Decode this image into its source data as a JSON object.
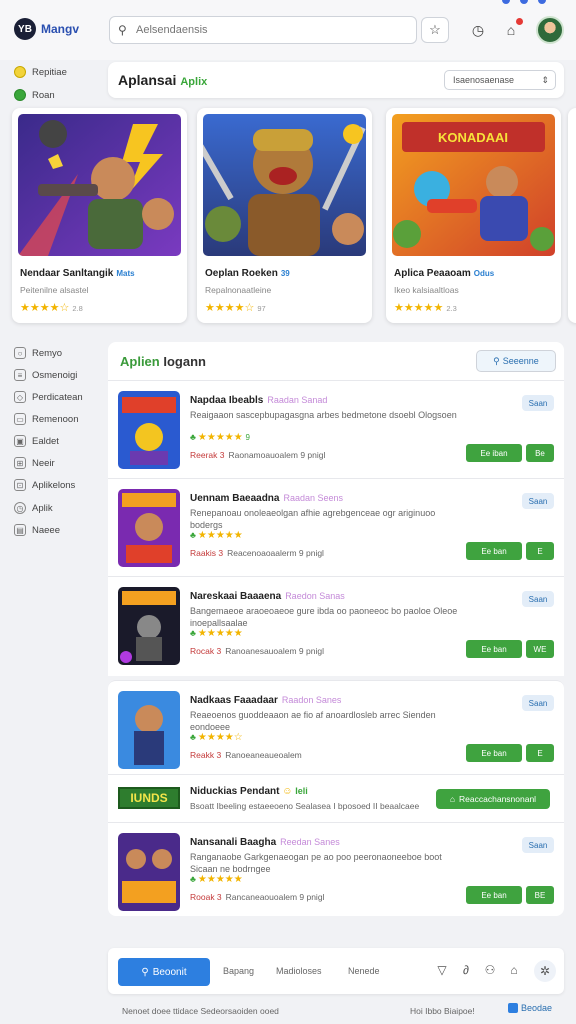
{
  "header": {
    "logo_text": "YB",
    "brand": "Mangv",
    "search_placeholder": "Aelsendaensis",
    "topdots": [
      "",
      "",
      ""
    ]
  },
  "sidebar_top": [
    {
      "label": "Repitiae",
      "icon": "star-icon"
    },
    {
      "label": "Roan",
      "icon": "leaf-icon"
    }
  ],
  "sidebar_nav": [
    {
      "label": "Remyo",
      "icon": "user-icon"
    },
    {
      "label": "Osmenoigi",
      "icon": "document-icon"
    },
    {
      "label": "Perdicatean",
      "icon": "tag-icon"
    },
    {
      "label": "Remenoon",
      "icon": "folder-icon"
    },
    {
      "label": "Ealdet",
      "icon": "image-icon"
    },
    {
      "label": "Neeir",
      "icon": "grid-icon"
    },
    {
      "label": "Aplikelons",
      "icon": "cart-icon"
    },
    {
      "label": "Aplik",
      "icon": "clock-icon"
    },
    {
      "label": "Naeee",
      "icon": "box-icon"
    }
  ],
  "featured": {
    "title": "Aplansai",
    "title_accent": "Aplix",
    "select_value": "Isaenosaenase",
    "cards": [
      {
        "title": "Nendaar Sanltangik",
        "tag": "Mats",
        "sub": "Peitenilne alsastel",
        "stars": "★★★★☆",
        "count": "2.8"
      },
      {
        "title": "Oeplan Roeken",
        "tag": "39",
        "sub": "Repalnonaatleine",
        "stars": "★★★★☆",
        "count": "97"
      },
      {
        "title": "Aplica Peaaoam",
        "tag": "Odus",
        "sub": "Ikeo kalsiaaltloas",
        "stars": "★★★★★",
        "count": "2.3"
      }
    ]
  },
  "list": {
    "title": "Aplien",
    "title2": "Iogann",
    "button": "Seeenne",
    "rows": [
      {
        "title": "Napdaa Ibeabls",
        "cat": "Raadan Sanad",
        "desc": "Reaigaaon sascepbupagasgna arbes bedmetone dsoebl Ologsoen",
        "stars": "★★★★★",
        "score": "9",
        "meta_red": "Reerak 3",
        "meta": "Raonamoauoalem   9 pnigl",
        "tag": "Saan",
        "b1": "Ee iban",
        "b2": "Be"
      },
      {
        "title": "Uennam Baeaadna",
        "cat": "Raadan Seens",
        "desc": "Renepanoau onoleaeolgan afhie agrebgenceae ogr ariginuoo bodergs",
        "stars": "★★★★★",
        "score": "",
        "meta_red": "Raakis 3",
        "meta": "Reacenoaoaalerm   9 pnigl",
        "tag": "Saan",
        "b1": "Ee ban",
        "b2": "E"
      },
      {
        "title": "Nareskaai Baaaena",
        "cat": "Raedon Sanas",
        "desc": "Bangemaeoe araoeoaeoe gure ibda oo paoneeoc bo paoloe Oleoe inoepallsaalae",
        "stars": "★★★★★",
        "score": "",
        "meta_red": "Rocak 3",
        "meta": "Ranoanesauoalem   9 pnigl",
        "tag": "Saan",
        "b1": "Ee ban",
        "b2": "WE"
      },
      {
        "title": "Nadkaas Faaadaar",
        "cat": "Raadon Sanes",
        "desc": "Reaeoenos guoddeaaon ae fio af anoardlosleb arrec Sienden eondoeee",
        "stars": "★★★★☆",
        "score": "",
        "meta_red": "Reakk 3",
        "meta": "Ranoeaneaueoalem",
        "tag": "Saan",
        "b1": "Ee ban",
        "b2": "E"
      },
      {
        "title": "Nansanali Baagha",
        "cat": "Reedan Sanes",
        "desc": "Ranganaobe Garkgenaeogan pe ao poo peeronaoneeboe boot Sicaan ne bodrngee",
        "stars": "★★★★★",
        "score": "",
        "meta_red": "Rooak 3",
        "meta": "Rancaneaouoalem   9 pnigl",
        "tag": "Saan",
        "b1": "Ee ban",
        "b2": "BE"
      }
    ]
  },
  "promo": {
    "logo": "IUNDS",
    "title": "Niduckias Pendant",
    "emoji": "☺",
    "grn": "Ieli",
    "sub": "Bsoatt  Ibeeling estaeeoeno Sealasea  I bposoed II beaalcaee",
    "button": "Reaccachansnonanl"
  },
  "bottom": {
    "search": "Beoonit",
    "links": [
      "Bapang",
      "Madioloses",
      "Nenede"
    ]
  },
  "footer": {
    "left": "Nenoet doee ttidace Sedeorsaoiden ooed",
    "right": "Hoi Ibbo Biaipoe!",
    "brand": "Beodae"
  }
}
